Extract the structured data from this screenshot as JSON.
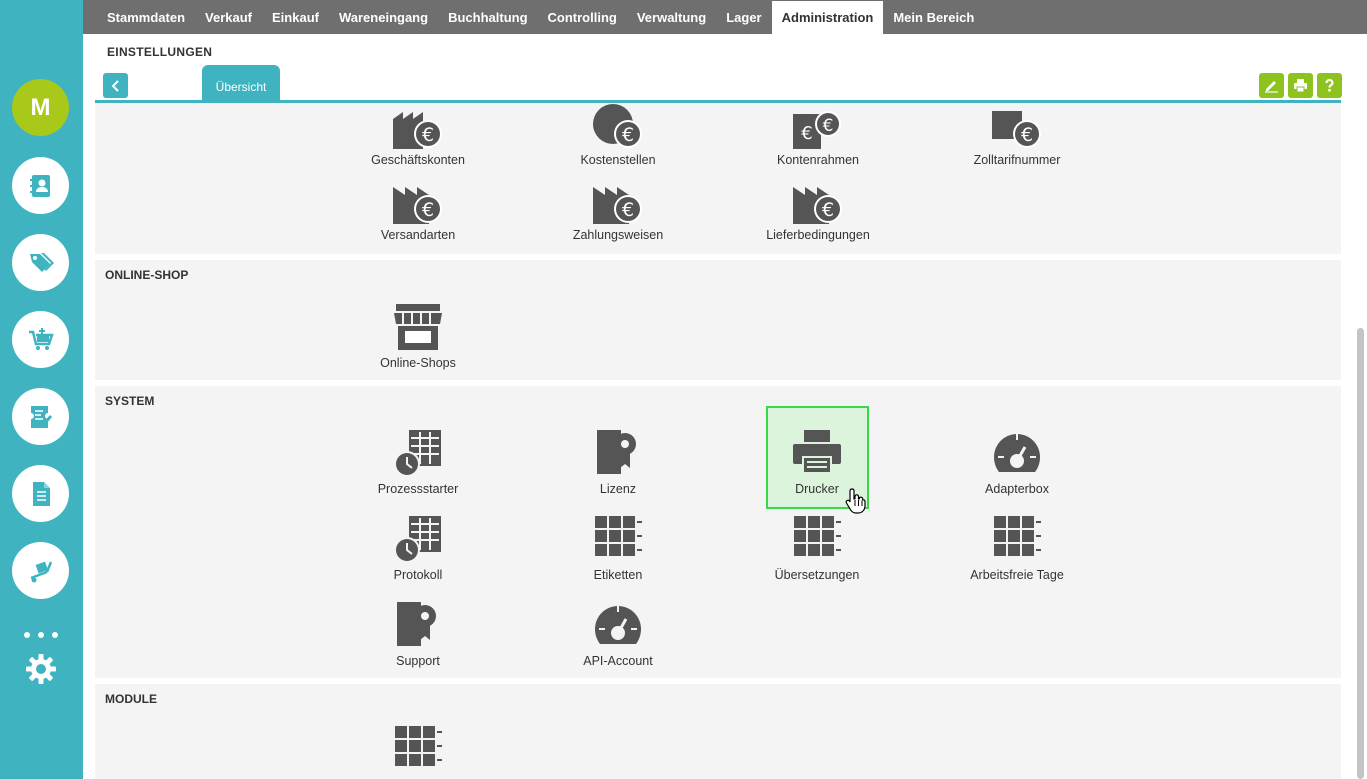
{
  "user": {
    "initial": "M"
  },
  "nav": {
    "items": [
      {
        "label": "Stammdaten"
      },
      {
        "label": "Verkauf"
      },
      {
        "label": "Einkauf"
      },
      {
        "label": "Wareneingang"
      },
      {
        "label": "Buchhaltung"
      },
      {
        "label": "Controlling"
      },
      {
        "label": "Verwaltung"
      },
      {
        "label": "Lager"
      },
      {
        "label": "Administration",
        "active": true
      },
      {
        "label": "Mein Bereich"
      }
    ]
  },
  "header": {
    "title": "EINSTELLUNGEN",
    "tab_label": "Übersicht"
  },
  "sidebar": {
    "icons": [
      "contacts-book-icon",
      "price-tag-icon",
      "shopping-cart-icon",
      "checklist-ticket-icon",
      "document-icon",
      "hand-truck-icon",
      "more-dots-icon",
      "gear-icon"
    ]
  },
  "toolbar": {
    "icons": [
      "edit-pencil-icon",
      "print-icon",
      "help-icon"
    ],
    "color": "#8ec31f"
  },
  "sections": {
    "finance": {
      "row1": [
        "Geschäftskonten",
        "Kostenstellen",
        "Kontenrahmen",
        "Zolltarifnummer"
      ],
      "row2": [
        "Versandarten",
        "Zahlungsweisen",
        "Lieferbedingungen"
      ]
    },
    "online_shop": {
      "title": "ONLINE-SHOP",
      "items": [
        "Online-Shops"
      ]
    },
    "system": {
      "title": "SYSTEM",
      "items": [
        "Prozessstarter",
        "Lizenz",
        "Drucker",
        "Adapterbox",
        "Protokoll",
        "Etiketten",
        "Übersetzungen",
        "Arbeitsfreie Tage",
        "Support",
        "API-Account"
      ],
      "highlighted": "Drucker"
    },
    "module": {
      "title": "MODULE"
    }
  },
  "colors": {
    "accent": "#3fb3bf",
    "avatar": "#a8c81a",
    "nav_bg": "#6f6f6f",
    "icon": "#555555",
    "highlight_border": "#38d84a"
  }
}
